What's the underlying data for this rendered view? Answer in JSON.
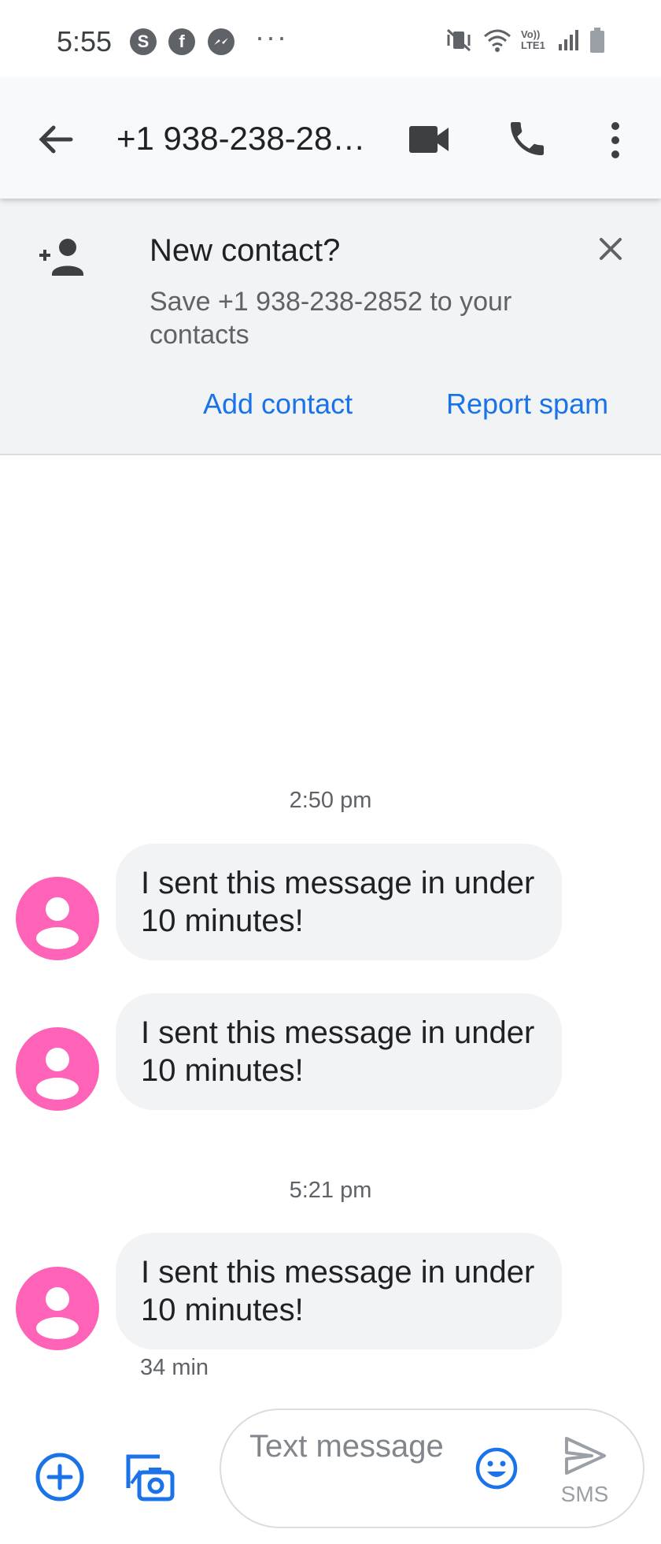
{
  "status_bar": {
    "time": "5:55",
    "app_icons": [
      "skype-icon",
      "facebook-icon",
      "messenger-icon"
    ],
    "more": "···",
    "network_label": "Vo)) LTE1"
  },
  "app_bar": {
    "title": "+1 938-238-28…",
    "icons": [
      "back-arrow-icon",
      "video-call-icon",
      "phone-icon",
      "more-vert-icon"
    ]
  },
  "banner": {
    "title": "New contact?",
    "text": "Save +1 938-238-2852 to your contacts",
    "add_contact": "Add contact",
    "report_spam": "Report spam"
  },
  "conversation": {
    "groups": [
      {
        "timestamp": "2:50 pm",
        "messages": [
          {
            "text": "I sent this message in under 10 minutes!"
          },
          {
            "text": "I sent this message in under 10 minutes!"
          }
        ]
      },
      {
        "timestamp": "5:21 pm",
        "messages": [
          {
            "text": "I sent this message in under 10 minutes!",
            "meta": "34 min"
          }
        ]
      }
    ]
  },
  "compose": {
    "placeholder": "Text message",
    "send_label": "SMS"
  },
  "colors": {
    "accent": "#1a73e8",
    "avatar": "#ff63b8",
    "bubble": "#f1f3f4",
    "banner": "#f1f3f4",
    "appbar": "#f8f9fa"
  }
}
